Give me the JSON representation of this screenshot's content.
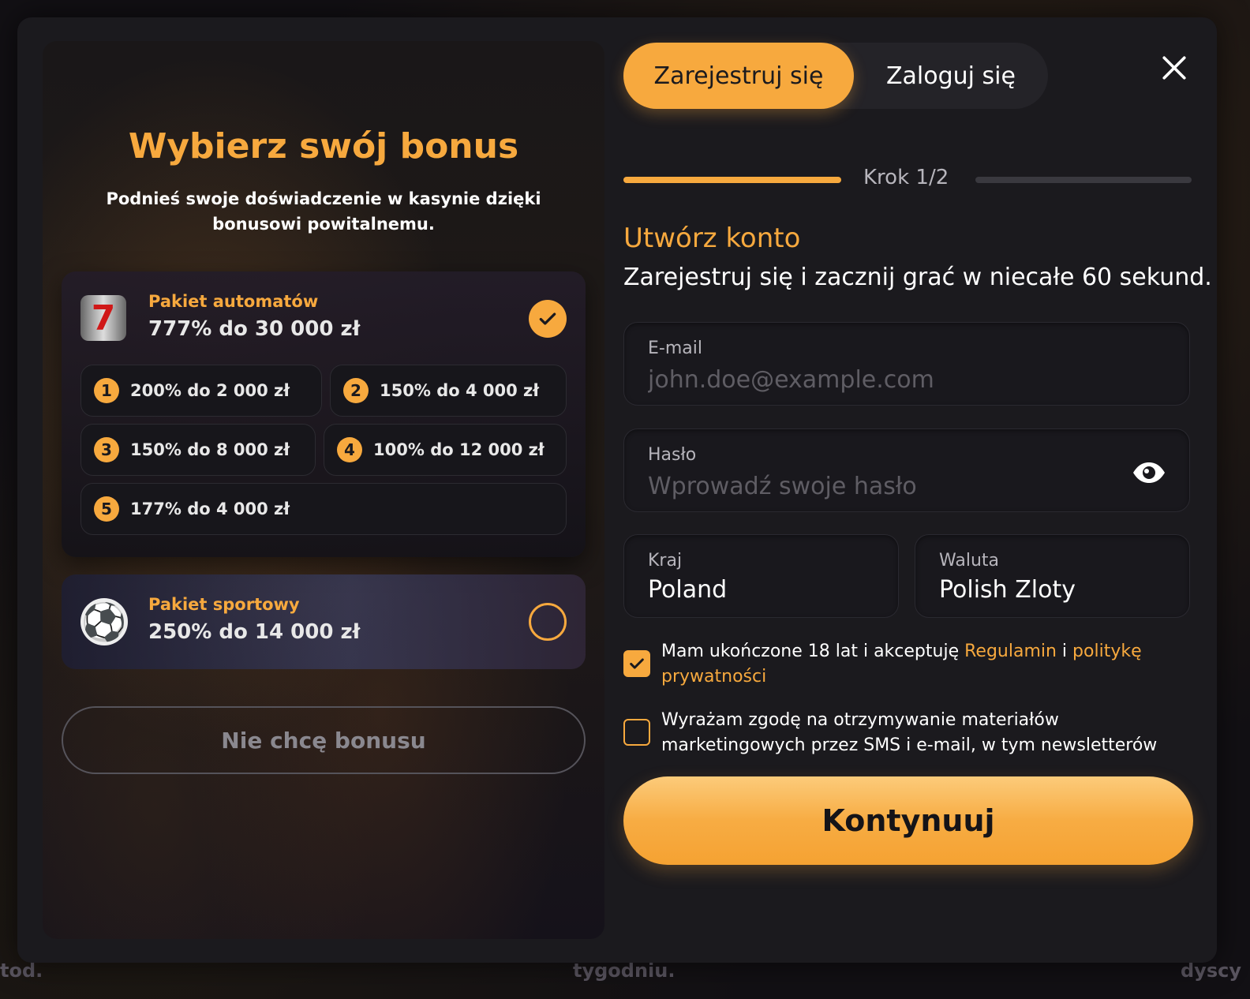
{
  "left": {
    "title": "Wybierz swój bonus",
    "subtitle": "Podnieś swoje doświadczenie w kasynie dzięki bonusowi powitalnemu.",
    "slots_package": {
      "name": "Pakiet automatów",
      "amount": "777% do 30 000 zł",
      "selected": true,
      "tiers": [
        {
          "num": "1",
          "text": "200% do 2 000 zł"
        },
        {
          "num": "2",
          "text": "150% do 4 000 zł"
        },
        {
          "num": "3",
          "text": "150% do 8 000 zł"
        },
        {
          "num": "4",
          "text": "100% do 12 000 zł"
        },
        {
          "num": "5",
          "text": "177% do 4 000 zł"
        }
      ]
    },
    "sport_package": {
      "name": "Pakiet sportowy",
      "amount": "250% do 14 000 zł",
      "selected": false
    },
    "no_bonus_label": "Nie chcę bonusu"
  },
  "tabs": {
    "register": "Zarejestruj się",
    "login": "Zaloguj się"
  },
  "step": {
    "label": "Krok 1/2"
  },
  "form": {
    "title": "Utwórz konto",
    "subtitle": "Zarejestruj się i zacznij grać w niecałe 60 sekund.",
    "email": {
      "label": "E-mail",
      "placeholder": "john.doe@example.com",
      "value": ""
    },
    "password": {
      "label": "Hasło",
      "placeholder": "Wprowadź swoje hasło",
      "value": ""
    },
    "country": {
      "label": "Kraj",
      "value": "Poland"
    },
    "currency": {
      "label": "Waluta",
      "value": "Polish Zloty"
    },
    "consent_terms": {
      "checked": true,
      "text_before": "Mam ukończone 18 lat i akceptuję ",
      "link_terms": "Regulamin",
      "text_and": " i ",
      "link_privacy": "politykę prywatności"
    },
    "consent_marketing": {
      "checked": false,
      "text": "Wyrażam zgodę na otrzymywanie materiałów marketingowych przez SMS i e-mail, w tym newsletterów"
    },
    "continue_label": "Kontynuuj"
  },
  "background_text": {
    "bottom_middle": "tygodniu.",
    "bottom_left": "tod.",
    "bottom_right": "dyscy"
  },
  "colors": {
    "accent": "#f7a93e",
    "modal_bg": "#1b1a1e",
    "field_bg": "#19181d"
  },
  "icons": {
    "close": "close-icon",
    "eye": "eye-icon",
    "check": "check-icon",
    "slot": "slot-machine-icon",
    "ball": "soccer-ball-icon"
  }
}
